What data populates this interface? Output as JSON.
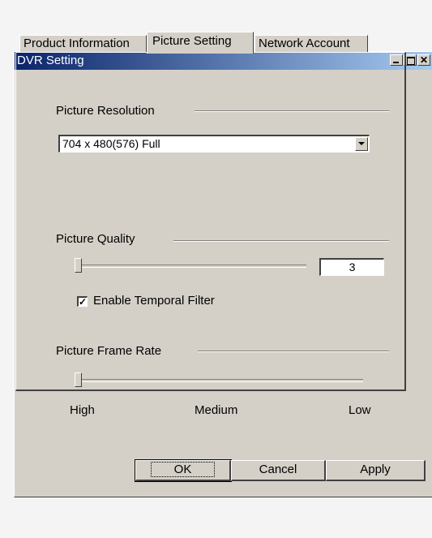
{
  "window": {
    "title": "DVR Setting",
    "caption_buttons": [
      "minimize-icon",
      "maximize-icon",
      "close-icon"
    ],
    "colors": {
      "title_start": "#0a246a",
      "title_end": "#a6caf0",
      "face": "#d4d0c8"
    }
  },
  "tabs": [
    {
      "label": "Product Information",
      "active": false
    },
    {
      "label": "Picture Setting",
      "active": true
    },
    {
      "label": "Network Account",
      "active": false
    }
  ],
  "resolution": {
    "label": "Picture Resolution",
    "selected": "704 x 480(576) Full"
  },
  "quality": {
    "label": "Picture Quality",
    "value": "3",
    "slider_level": 0
  },
  "temporal_filter": {
    "label": "Enable Temporal Filter",
    "checked": true,
    "check_mark": "✓"
  },
  "frame_rate": {
    "label": "Picture Frame Rate",
    "slider_level": 0,
    "scale_labels": [
      "High",
      "Medium",
      "Low"
    ]
  },
  "buttons": {
    "ok": "OK",
    "cancel": "Cancel",
    "apply": "Apply"
  }
}
